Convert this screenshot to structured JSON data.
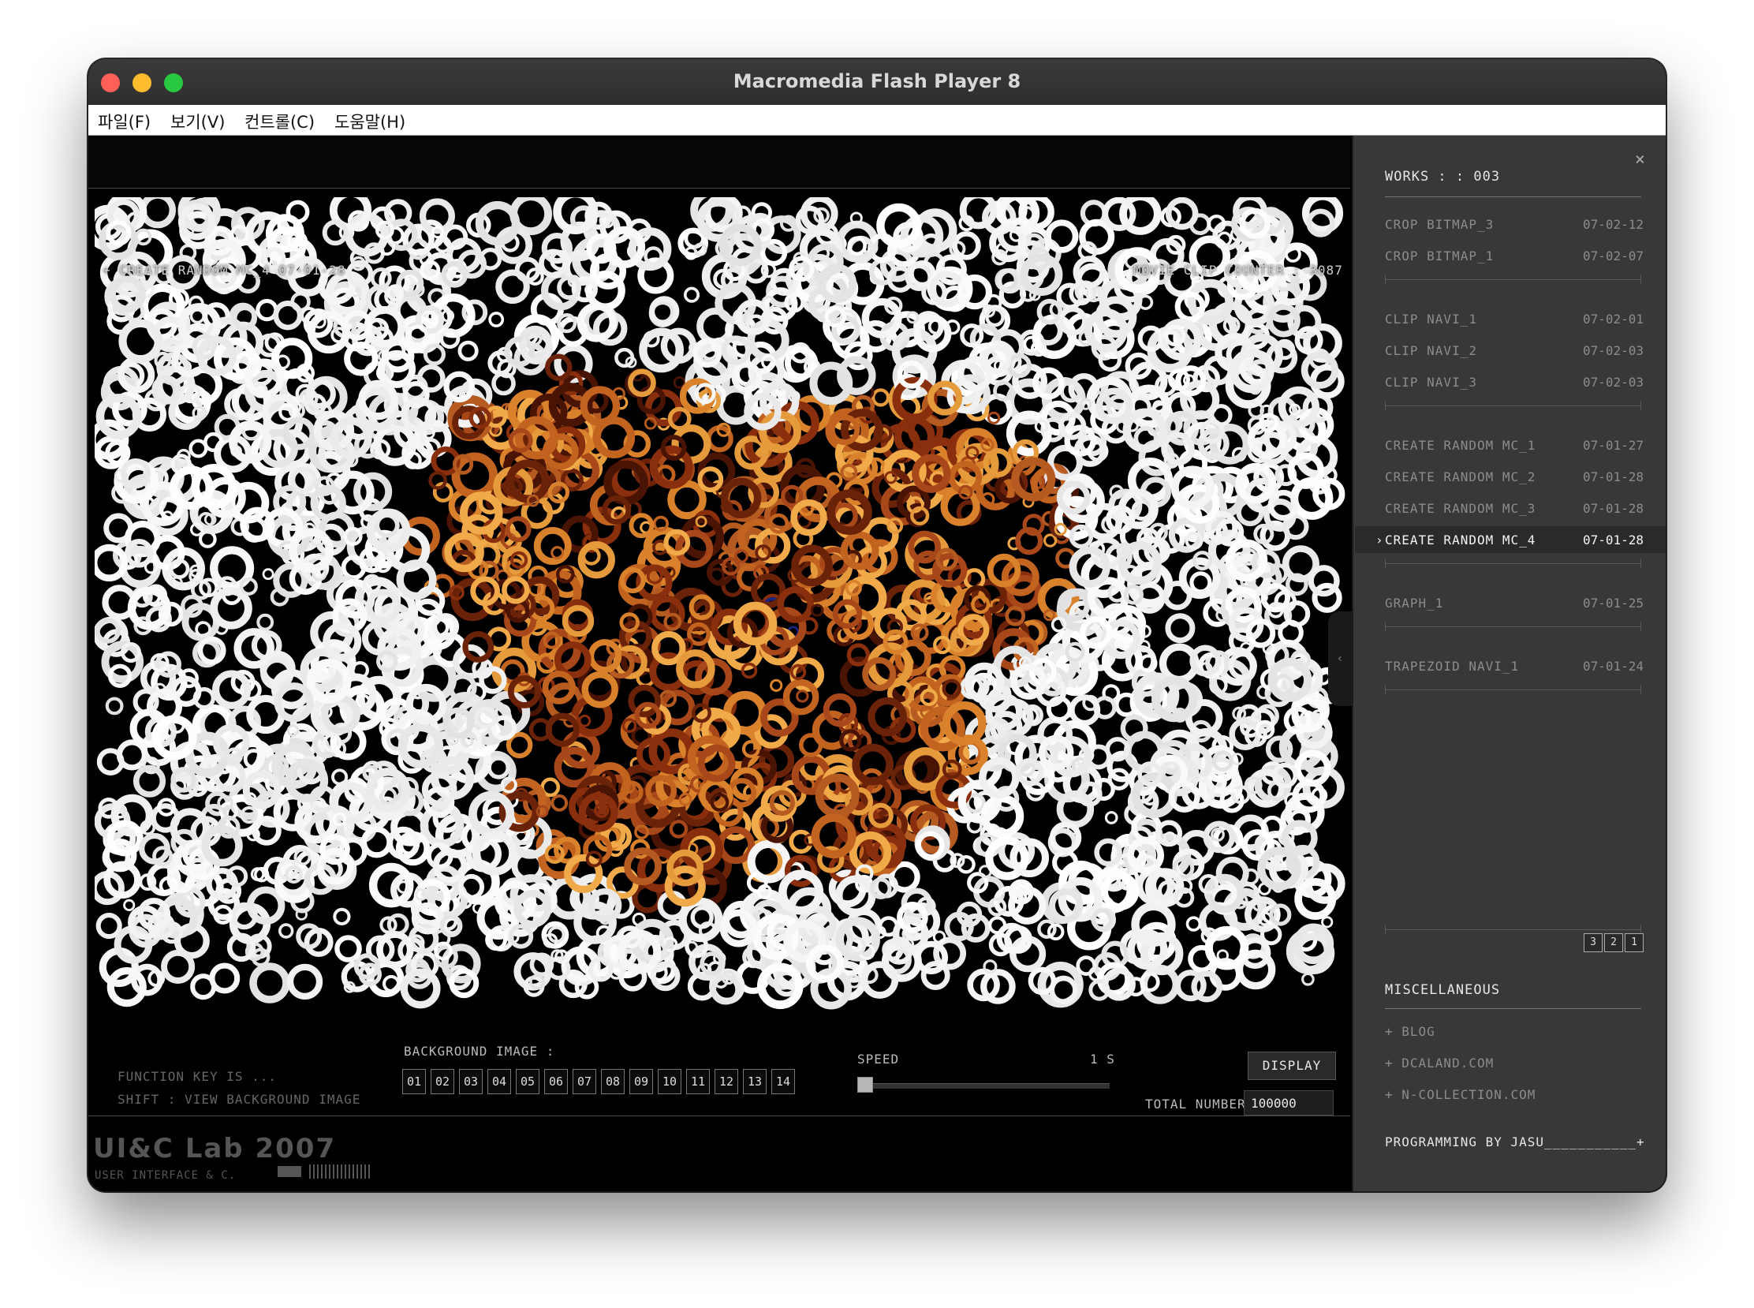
{
  "window": {
    "title": "Macromedia Flash Player 8"
  },
  "menu": [
    {
      "label": "파일(F)"
    },
    {
      "label": "보기(V)"
    },
    {
      "label": "컨트롤(C)"
    },
    {
      "label": "도움말(H)"
    }
  ],
  "stage": {
    "caption": "+ CREATE RANDOM MC_4 07-01-28",
    "counter": "MOVIE CLIP COUNTER : 3087",
    "function_key_title": "FUNCTION KEY IS ...",
    "function_key_desc": "SHIFT : VIEW BACKGROUND IMAGE",
    "background_image_label": "BACKGROUND IMAGE :",
    "background_buttons": [
      "01",
      "02",
      "03",
      "04",
      "05",
      "06",
      "07",
      "08",
      "09",
      "10",
      "11",
      "12",
      "13",
      "14"
    ],
    "speed_label": "SPEED",
    "speed_value": "1 S",
    "speed_level": 0,
    "display_label": "DISPLAY",
    "total_label": "TOTAL NUMBER :",
    "total_value": "100000",
    "logo": "UI&C Lab 2007",
    "logo_sub": "USER INTERFACE & C."
  },
  "sidebar": {
    "header": "WORKS : : 003",
    "close_icon": "close-icon",
    "groups": [
      {
        "items": [
          {
            "name": "CROP BITMAP_3",
            "date": "07-02-12"
          },
          {
            "name": "CROP BITMAP_1",
            "date": "07-02-07"
          }
        ]
      },
      {
        "items": [
          {
            "name": "CLIP NAVI_1",
            "date": "07-02-01"
          },
          {
            "name": "CLIP NAVI_2",
            "date": "07-02-03"
          },
          {
            "name": "CLIP NAVI_3",
            "date": "07-02-03"
          }
        ]
      },
      {
        "items": [
          {
            "name": "CREATE RANDOM MC_1",
            "date": "07-01-27"
          },
          {
            "name": "CREATE RANDOM MC_2",
            "date": "07-01-28"
          },
          {
            "name": "CREATE RANDOM MC_3",
            "date": "07-01-28"
          },
          {
            "name": "CREATE RANDOM MC_4",
            "date": "07-01-28",
            "active": true
          }
        ]
      },
      {
        "items": [
          {
            "name": "GRAPH_1",
            "date": "07-01-25"
          }
        ]
      },
      {
        "items": [
          {
            "name": "TRAPEZOID NAVI_1",
            "date": "07-01-24"
          }
        ]
      }
    ],
    "pages": [
      "3",
      "2",
      "1"
    ],
    "misc_header": "MISCELLANEOUS",
    "links": [
      "+ BLOG",
      "+ DCALAND.COM",
      "+ N-COLLECTION.COM"
    ],
    "footer": "PROGRAMMING BY JASU___________+"
  },
  "colors": {
    "ring_white": "#ffffff",
    "ring_orange": "#d9822b",
    "ring_brown": "#7a2d0c",
    "sidebar_bg": "#383838"
  }
}
